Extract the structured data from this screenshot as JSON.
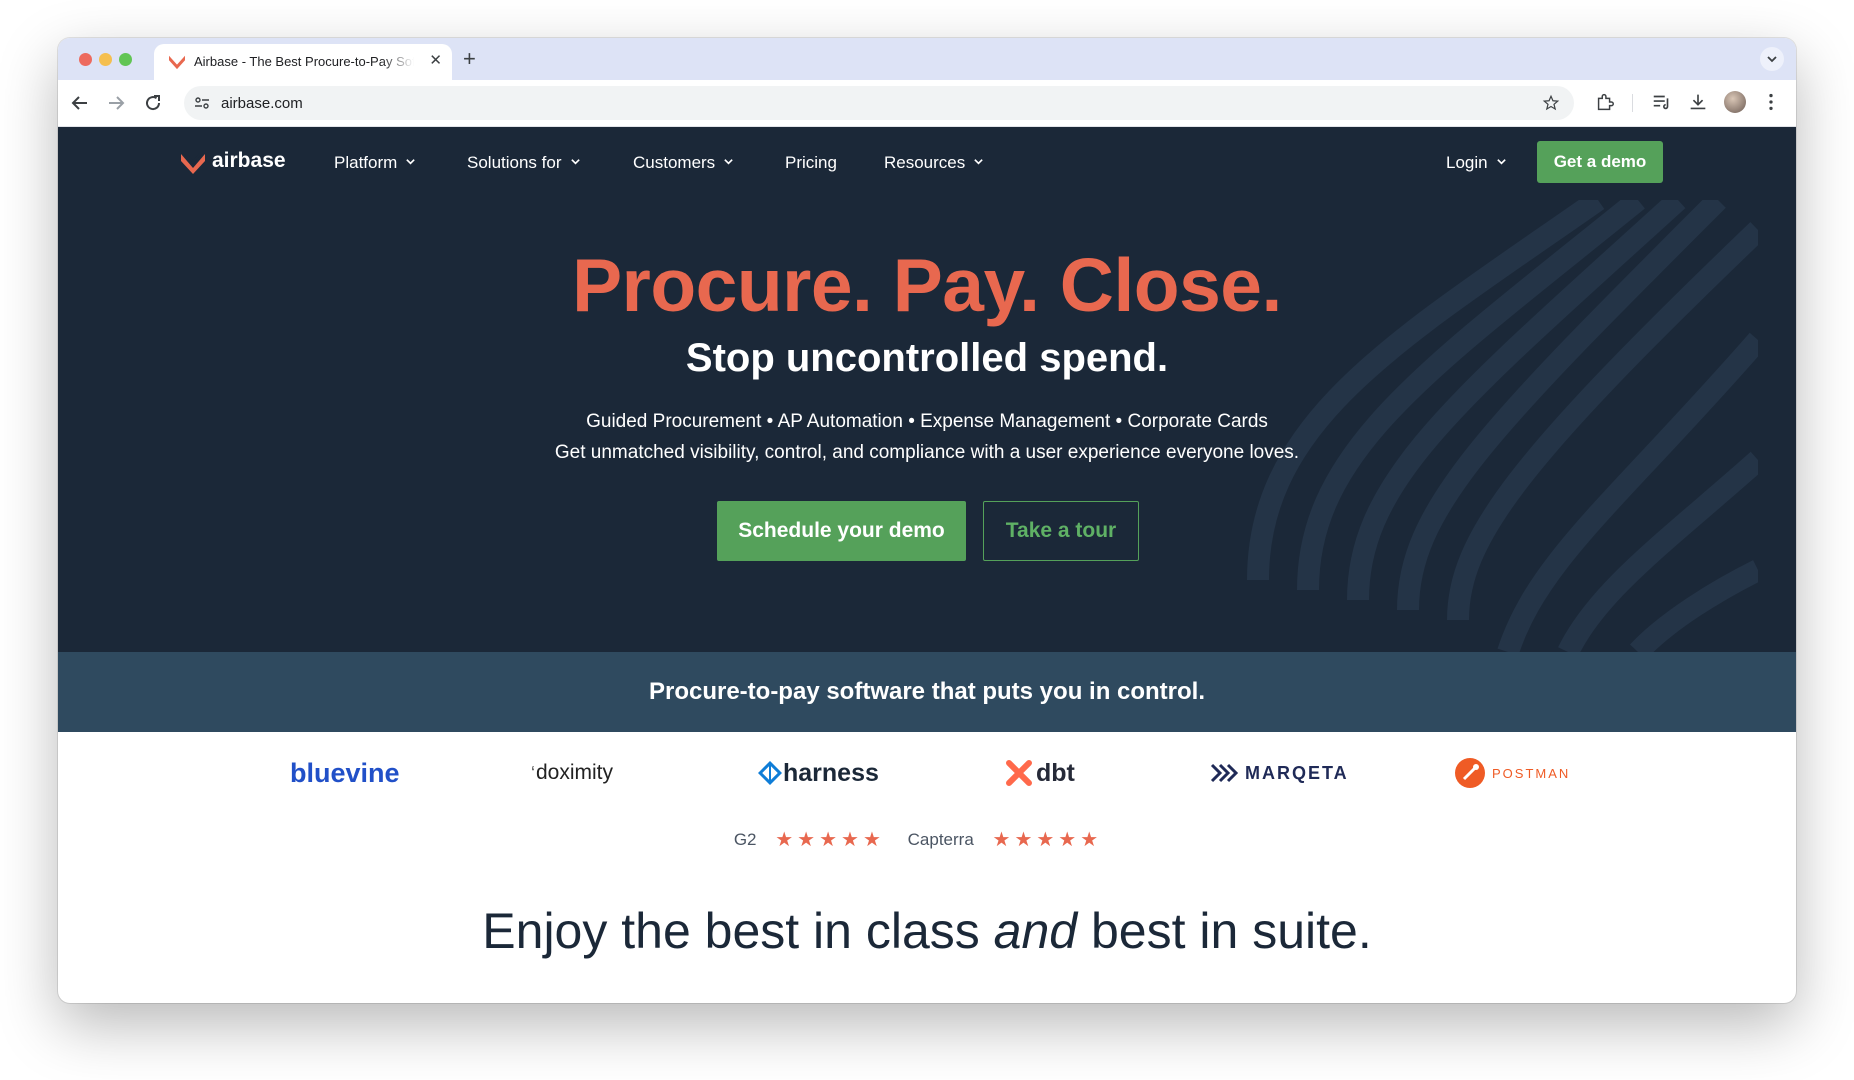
{
  "browser": {
    "tab_title": "Airbase - The Best Procure-to-Pay Software",
    "url": "airbase.com"
  },
  "nav": {
    "brand": "airbase",
    "items": [
      "Platform",
      "Solutions for",
      "Customers",
      "Pricing",
      "Resources"
    ],
    "login": "Login",
    "cta": "Get a demo"
  },
  "hero": {
    "title": "Procure. Pay. Close.",
    "subtitle": "Stop uncontrolled spend.",
    "line1": "Guided Procurement • AP Automation • Expense Management • Corporate Cards",
    "line2": "Get unmatched visibility, control, and compliance with a user experience everyone loves.",
    "primary_button": "Schedule your demo",
    "secondary_button": "Take a tour"
  },
  "band": {
    "text": "Procure-to-pay software that puts you in control."
  },
  "logos": [
    "bluevine",
    "doximity",
    "harness",
    "dbt",
    "MARQETA",
    "POSTMAN"
  ],
  "ratings": [
    {
      "source": "G2",
      "stars": 5
    },
    {
      "source": "Capterra",
      "stars": 5
    }
  ],
  "section": {
    "headline_part1": "Enjoy the best in class ",
    "headline_em": "and",
    "headline_part2": " best in suite."
  },
  "colors": {
    "navy": "#1b2838",
    "coral": "#e8684f",
    "green": "#55a15a",
    "band": "#2f4a5f"
  }
}
